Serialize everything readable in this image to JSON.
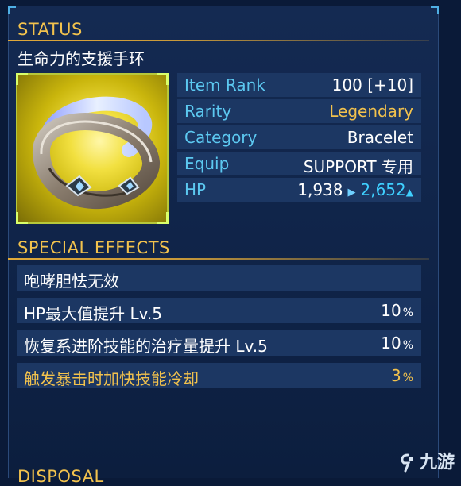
{
  "status": {
    "title": "STATUS",
    "item_name": "生命力的支援手环",
    "icon": "bracelet-icon",
    "stats": [
      {
        "label": "Item Rank",
        "value": "100 [+10]"
      },
      {
        "label": "Rarity",
        "value": "Legendary"
      },
      {
        "label": "Category",
        "value": "Bracelet"
      },
      {
        "label": "Equip",
        "value": "SUPPORT 专用"
      }
    ],
    "hp": {
      "label": "HP",
      "current": "1,938",
      "new": "2,652"
    }
  },
  "special_effects": {
    "title": "SPECIAL EFFECTS",
    "items": [
      {
        "label": "咆哮胆怯无效",
        "value": "",
        "unit": ""
      },
      {
        "label": "HP最大值提升 Lv.5",
        "value": "10",
        "unit": "%"
      },
      {
        "label": "恢复系进阶技能的治疗量提升 Lv.5",
        "value": "10",
        "unit": "%"
      },
      {
        "label": "触发暴击时加快技能冷却",
        "value": "3",
        "unit": "%"
      }
    ]
  },
  "next_section": {
    "title": "DISPOSAL"
  },
  "watermark": {
    "text": "九游"
  },
  "colors": {
    "accent_gold": "#f2c24d",
    "label_cyan": "#5cc8f0",
    "row_bg": "#1c3763",
    "panel_bg": "#142a52"
  }
}
